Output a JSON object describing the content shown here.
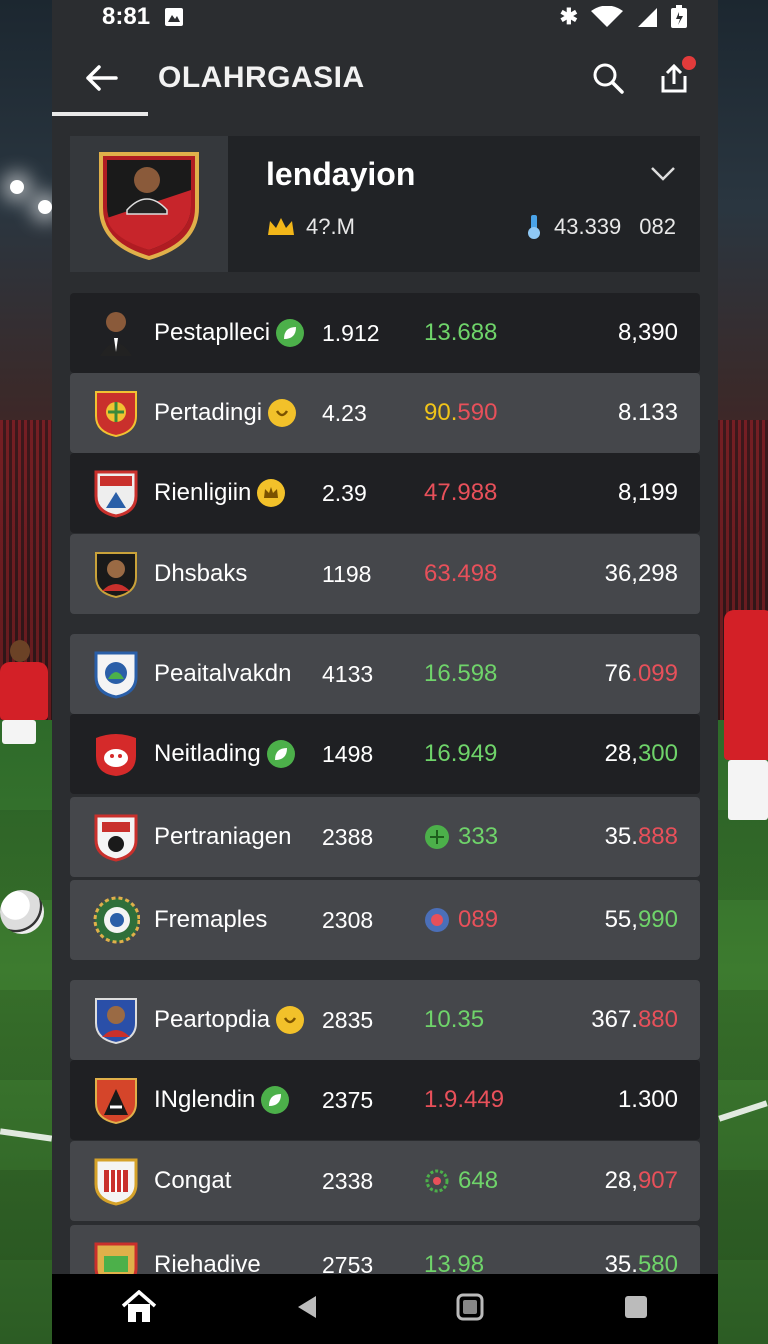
{
  "status": {
    "time": "8:81"
  },
  "appbar": {
    "title": "OLAHRGASIA",
    "back_icon": "arrow-left-icon",
    "search_icon": "search-icon",
    "share_icon": "share-icon"
  },
  "profile": {
    "name": "lendayion",
    "stat_left": "4?.M",
    "stat_right_a": "43.339",
    "stat_right_b": "082"
  },
  "rows": [
    {
      "name": "Pestaplleci",
      "badge": "green",
      "c1": "1.912",
      "c2": "13.688",
      "c2_color": "g",
      "c3a": "8,390",
      "c3b": "",
      "c3b_color": ""
    },
    {
      "name": "Pertadingi",
      "badge": "yellow",
      "c1": "4.23",
      "c2a": "90.",
      "c2b": "590",
      "c3a": "8.133",
      "c3_color": "g"
    },
    {
      "name": "Rienligiin",
      "badge": "yellow",
      "c1": "2.39",
      "c2": "47.988",
      "c2_color": "r",
      "c3a": "8,199",
      "c3_color": "g"
    },
    {
      "name": "Dhsbaks",
      "badge": "",
      "c1": "1198",
      "c2": "63.498",
      "c2_color": "r",
      "c3a": "36,298",
      "c3_color": "lg"
    },
    {
      "name": "Peaitalvakdn",
      "badge": "",
      "c1": "4133",
      "c2": "16.598",
      "c2_color": "g",
      "c3a": "76",
      "c3b": ".099"
    },
    {
      "name": "Neitlading",
      "badge": "green",
      "c1": "1498",
      "c2": "16.949",
      "c2_color": "g",
      "c3a": "28,",
      "c3b": "300"
    },
    {
      "name": "Pertraniagen",
      "badge": "",
      "c1": "2388",
      "c2": "333",
      "c2_color": "g",
      "c3a": "35.",
      "c3b": "888"
    },
    {
      "name": "Fremaples",
      "badge": "",
      "c1": "2308",
      "c2": "089",
      "c2_color": "r",
      "c3a": "55,",
      "c3b": "990"
    },
    {
      "name": "Peartopdia",
      "badge": "yellow",
      "c1": "2835",
      "c2": "10.35",
      "c2_color": "g",
      "c3a": "367.",
      "c3b": "880"
    },
    {
      "name": "INglendin",
      "badge": "green",
      "c1": "2375",
      "c2": "1.9.449",
      "c2_color": "r",
      "c3a": "1.300",
      "c3_color": "g"
    },
    {
      "name": "Congat",
      "badge": "",
      "c1": "2338",
      "c2": "648",
      "c2_color": "g",
      "c3a": "28,",
      "c3b": "907"
    },
    {
      "name": "Riehadive",
      "badge": "",
      "c1": "2753",
      "c2": "13.98",
      "c2_color": "g",
      "c3a": "35.",
      "c3b": "580"
    }
  ],
  "nav": {
    "home_icon": "home-icon",
    "back_icon": "back-triangle-icon",
    "home_btn_icon": "home-square-icon",
    "recents_icon": "recents-icon"
  }
}
